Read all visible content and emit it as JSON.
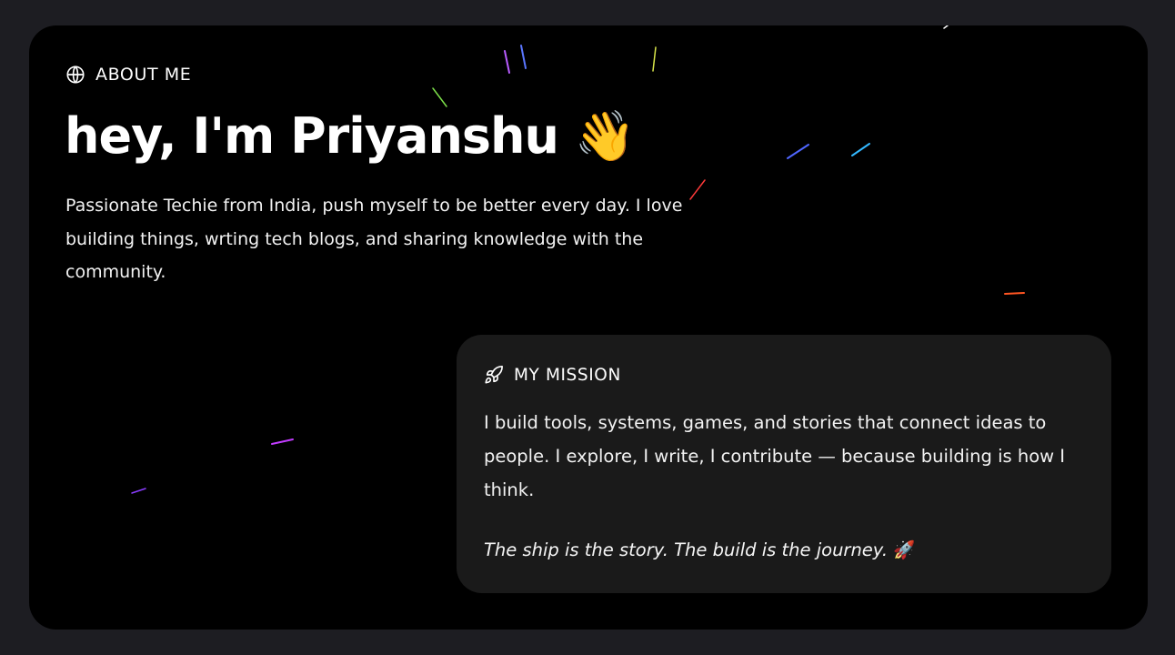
{
  "about": {
    "icon": "globe-icon",
    "label": "ABOUT ME",
    "headline": "hey, I'm Priyanshu",
    "headline_emoji": "👋",
    "intro": "Passionate Techie from India, push myself to be better every day. I love building things, wrting tech blogs, and sharing knowledge with the community."
  },
  "mission": {
    "icon": "rocket-icon",
    "label": "MY MISSION",
    "text": "I build tools, systems, games, and stories that connect ideas to people. I explore, I write, I contribute — because building is how I think.",
    "quote": "The ship is the story. The build is the journey.",
    "quote_emoji": "🚀"
  },
  "colors": {
    "page_background": "#1d1d22",
    "card_background": "#000000",
    "mission_background": "#1a1a1a",
    "text": "#ffffff"
  }
}
